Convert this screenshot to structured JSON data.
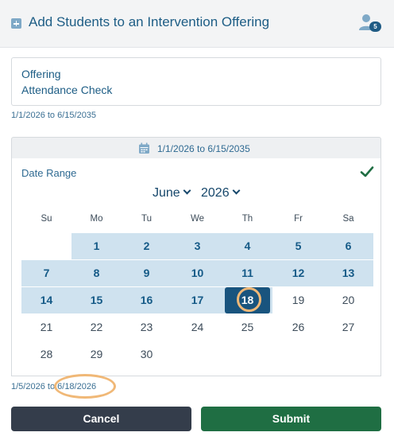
{
  "dialog": {
    "title": "Add Students to an Intervention Offering",
    "student_count": "5"
  },
  "offering": {
    "label": "Offering",
    "value": "Attendance Check",
    "date_range": "1/1/2026 to 6/15/2035"
  },
  "range_bar": {
    "text": "1/1/2026 to 6/15/2035"
  },
  "calendar": {
    "label": "Date Range",
    "month": "June",
    "year": "2026",
    "weekdays": [
      "Su",
      "Mo",
      "Tu",
      "We",
      "Th",
      "Fr",
      "Sa"
    ],
    "weeks": [
      [
        "",
        "1",
        "2",
        "3",
        "4",
        "5",
        "6"
      ],
      [
        "7",
        "8",
        "9",
        "10",
        "11",
        "12",
        "13"
      ],
      [
        "14",
        "15",
        "16",
        "17",
        "18",
        "19",
        "20"
      ],
      [
        "21",
        "22",
        "23",
        "24",
        "25",
        "26",
        "27"
      ],
      [
        "28",
        "29",
        "30",
        "",
        "",
        "",
        ""
      ]
    ],
    "range_start_day": 1,
    "range_end_day": 18,
    "selected_day": 18
  },
  "selection": {
    "start": "1/5/2026",
    "connector": "to",
    "end": "6/18/2026"
  },
  "buttons": {
    "cancel": "Cancel",
    "submit": "Submit"
  },
  "colors": {
    "accent": "#1d5d85",
    "range_fill": "#cfe2ef",
    "selected": "#19547e",
    "annotation_ring": "#f0b877",
    "cancel_bg": "#343d4b",
    "submit_bg": "#1f6e43"
  }
}
